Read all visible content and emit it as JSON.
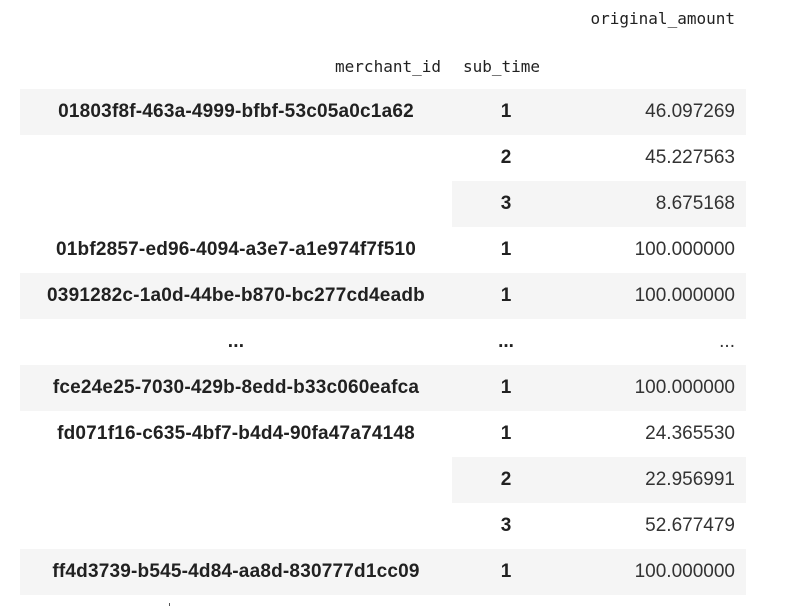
{
  "table": {
    "value_column_header": "original_amount",
    "index_headers": {
      "merchant_id": "merchant_id",
      "sub_time": "sub_time"
    },
    "colors": {
      "stripe": "#f5f5f5",
      "text": "#212121"
    },
    "rows": [
      {
        "merchant_id": "01803f8f-463a-4999-bfbf-53c05a0c1a62",
        "sub_time": "1",
        "original_amount": "46.097269"
      },
      {
        "merchant_id": "",
        "sub_time": "2",
        "original_amount": "45.227563"
      },
      {
        "merchant_id": "",
        "sub_time": "3",
        "original_amount": "8.675168"
      },
      {
        "merchant_id": "01bf2857-ed96-4094-a3e7-a1e974f7f510",
        "sub_time": "1",
        "original_amount": "100.000000"
      },
      {
        "merchant_id": "0391282c-1a0d-44be-b870-bc277cd4eadb",
        "sub_time": "1",
        "original_amount": "100.000000"
      },
      {
        "merchant_id": "...",
        "sub_time": "...",
        "original_amount": "..."
      },
      {
        "merchant_id": "fce24e25-7030-429b-8edd-b33c060eafca",
        "sub_time": "1",
        "original_amount": "100.000000"
      },
      {
        "merchant_id": "fd071f16-c635-4bf7-b4d4-90fa47a74148",
        "sub_time": "1",
        "original_amount": "24.365530"
      },
      {
        "merchant_id": "",
        "sub_time": "2",
        "original_amount": "22.956991"
      },
      {
        "merchant_id": "",
        "sub_time": "3",
        "original_amount": "52.677479"
      },
      {
        "merchant_id": "ff4d3739-b545-4d84-aa8d-830777d1cc09",
        "sub_time": "1",
        "original_amount": "100.000000"
      }
    ]
  }
}
